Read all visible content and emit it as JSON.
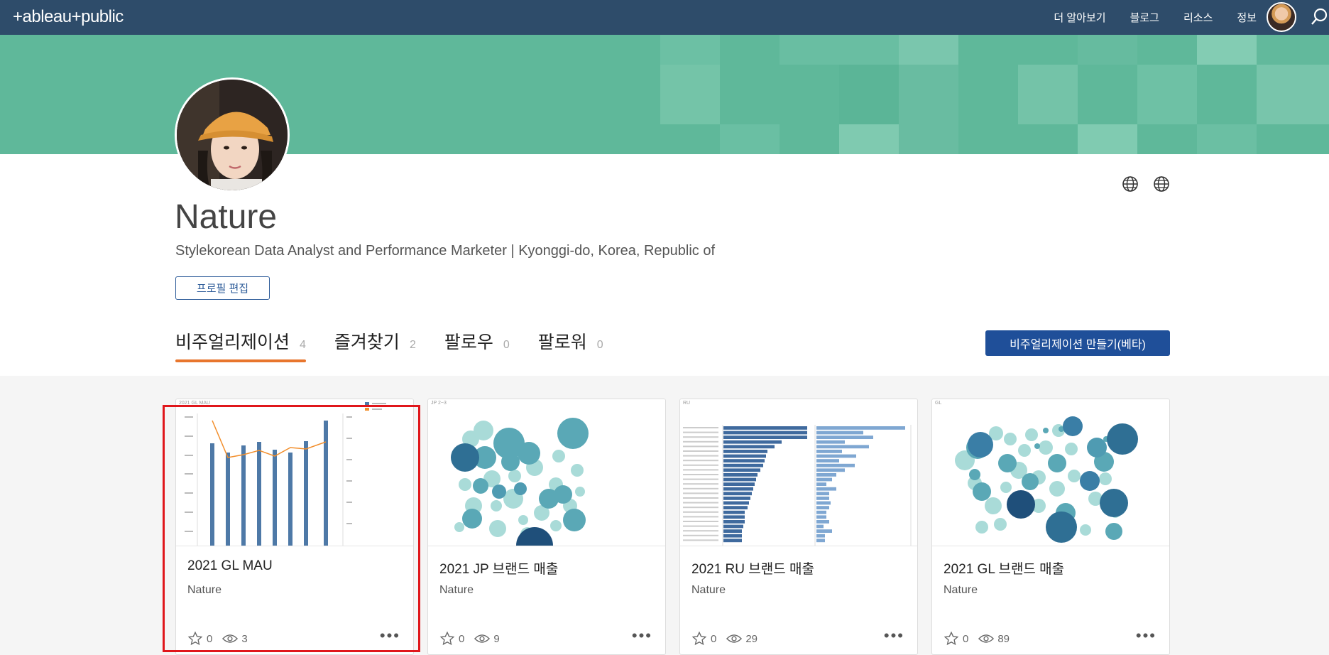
{
  "nav": {
    "logo": "+ableau+public",
    "links": [
      "더 알아보기",
      "블로그",
      "리소스",
      "정보"
    ]
  },
  "profile": {
    "name": "Nature",
    "description": "Stylekorean Data Analyst and Performance Marketer | Kyonggi-do, Korea, Republic of",
    "edit_label": "프로필 편집"
  },
  "tabs": [
    {
      "label": "비주얼리제이션",
      "count": "4"
    },
    {
      "label": "즐겨찾기",
      "count": "2"
    },
    {
      "label": "팔로우",
      "count": "0"
    },
    {
      "label": "팔로워",
      "count": "0"
    }
  ],
  "create_label": "비주얼리제이션 만들기(베타)",
  "cards": [
    {
      "title": "2021 GL MAU",
      "author": "Nature",
      "favorites": "0",
      "views": "3",
      "thumb_header": "2021 GL MAU"
    },
    {
      "title": "2021 JP 브랜드 매출",
      "author": "Nature",
      "favorites": "0",
      "views": "9",
      "thumb_header": "JP 2~3"
    },
    {
      "title": "2021 RU 브랜드 매출",
      "author": "Nature",
      "favorites": "0",
      "views": "29",
      "thumb_header": "RU"
    },
    {
      "title": "2021 GL 브랜드 매출",
      "author": "Nature",
      "favorites": "0",
      "views": "89",
      "thumb_header": "GL"
    }
  ],
  "colors": {
    "nav_bg": "#2e4c6a",
    "banner": "#5fb89a",
    "accent_orange": "#e8762d",
    "button_blue": "#1f4f99",
    "selection_red": "#e0161b"
  }
}
